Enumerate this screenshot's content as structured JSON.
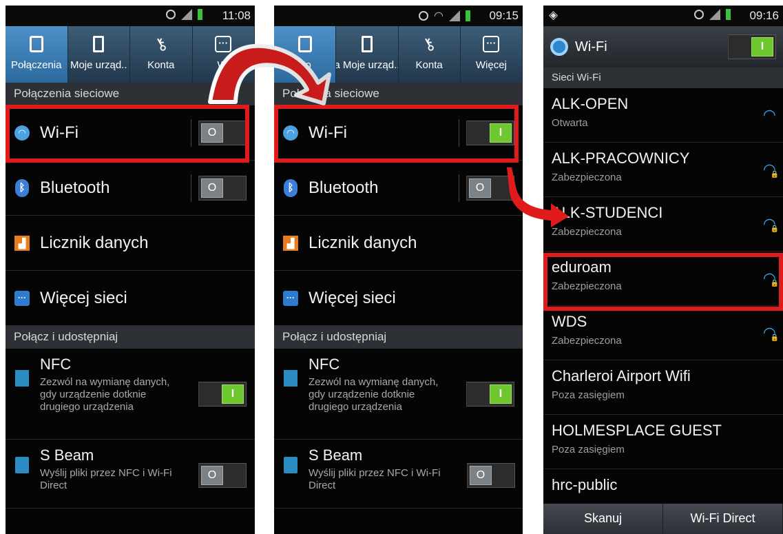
{
  "phone1": {
    "status": {
      "time": "11:08"
    },
    "tabs": [
      {
        "label": "Połączenia",
        "icon": "connections-icon"
      },
      {
        "label": "Moje urząd..",
        "icon": "device-icon"
      },
      {
        "label": "Konta",
        "icon": "key-icon"
      },
      {
        "label": "Wi",
        "icon": "more-icon"
      }
    ],
    "section_network": "Połączenia sieciowe",
    "wifi_label": "Wi-Fi",
    "wifi_toggle": "O",
    "bluetooth_label": "Bluetooth",
    "bluetooth_toggle": "O",
    "data_usage_label": "Licznik danych",
    "more_networks_label": "Więcej sieci",
    "section_share": "Połącz i udostępniaj",
    "nfc_title": "NFC",
    "nfc_desc": "Zezwól na wymianę danych, gdy urządzenie dotknie drugiego urządzenia",
    "nfc_toggle": "I",
    "sbeam_title": "S Beam",
    "sbeam_desc": "Wyślij pliki przez NFC i Wi-Fi Direct",
    "sbeam_toggle": "O"
  },
  "phone2": {
    "status": {
      "time": "09:15"
    },
    "tabs": [
      {
        "label": "Po",
        "icon": "connections-icon"
      },
      {
        "label": "a Moje urząd..",
        "icon": "device-icon"
      },
      {
        "label": "Konta",
        "icon": "key-icon"
      },
      {
        "label": "Więcej",
        "icon": "more-icon"
      }
    ],
    "section_network": "Połą  enia sieciowe",
    "wifi_label": "Wi-Fi",
    "wifi_toggle": "I",
    "bluetooth_label": "Bluetooth",
    "bluetooth_toggle": "O",
    "data_usage_label": "Licznik danych",
    "more_networks_label": "Więcej sieci",
    "section_share": "Połącz i udostępniaj",
    "nfc_title": "NFC",
    "nfc_desc": "Zezwól na wymianę danych, gdy urządzenie dotknie drugiego urządzenia",
    "nfc_toggle": "I",
    "sbeam_title": "S Beam",
    "sbeam_desc": "Wyślij pliki przez NFC i Wi-Fi Direct",
    "sbeam_toggle": "O"
  },
  "phone3": {
    "status": {
      "time": "09:16"
    },
    "header_title": "Wi-Fi",
    "header_toggle": "I",
    "section_title": "Sieci Wi-Fi",
    "networks": [
      {
        "name": "ALK-OPEN",
        "status": "Otwarta"
      },
      {
        "name": "ALK-PRACOWNICY",
        "status": "Zabezpieczona"
      },
      {
        "name": "ALK-STUDENCI",
        "status": "Zabezpieczona"
      },
      {
        "name": "eduroam",
        "status": "Zabezpieczona"
      },
      {
        "name": "WDS",
        "status": "Zabezpieczona"
      },
      {
        "name": "Charleroi Airport Wifi",
        "status": "Poza zasięgiem"
      },
      {
        "name": "HOLMESPLACE GUEST",
        "status": "Poza zasięgiem"
      },
      {
        "name": "hrc-public",
        "status": ""
      }
    ],
    "scan_label": "Skanuj",
    "wifi_direct_label": "Wi-Fi Direct"
  },
  "colors": {
    "highlight": "#e01b1b",
    "toggle_on": "#6ec72e",
    "tab_active": "#3f82bb"
  }
}
